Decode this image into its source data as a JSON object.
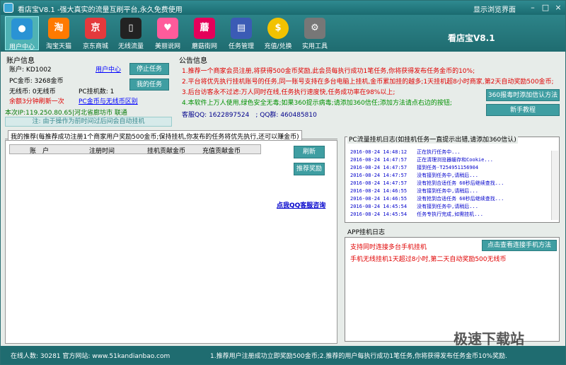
{
  "title": {
    "app": "看店宝V8.1",
    "slogan": "-强大真实的流量互刷平台,永久免费使用",
    "view": "显示浏览界面"
  },
  "toolbar": {
    "items": [
      "用户中心",
      "淘宝天猫",
      "京东商城",
      "无线流量",
      "美丽说网",
      "蘑菇街网",
      "任务管理",
      "充值/兑换",
      "实用工具"
    ],
    "brand": "看店宝V8.1"
  },
  "account": {
    "header": "账户信息",
    "account_label": "账户:",
    "account": "KD1002",
    "user_center": "用户中心",
    "pc_coins": "PC金币: 3268金币",
    "wireless": "无线币: 0无线币",
    "pc_hook": "PC挂机数: 1",
    "refresh": "余额3分钟刷新一次",
    "diff_link": "PC金币与无线币区别",
    "ip": "本次IP:119.250.80.65|河北省廊坊市 联通",
    "stop_btn": "停止任务",
    "pause_btn": "我的任务",
    "status_bar": "注: 由于操作为前时间过后间会自动挂机"
  },
  "announce": {
    "header": "公告信息",
    "lines": [
      "1.推荐一个商家会员注册,将获得500金币奖励,此会员每执行成功1笔任务,你将获得发布任务金币的10%;",
      "2.平台将优先执行挂机账号的任务,同一账号支持在多台电脑上挂机,金币累加挂的越多;1天挂机超8小时商家,第2天自动奖励500金币;",
      "3.后台访客永不过滤:万人同时在线,任务执行速度快,任务成功率在98%以上;",
      "4.本软件上万人使用,绿色安全无毒;如果360提示病毒;请添加360信任;添加方法请点右边的按钮;"
    ],
    "qq_label": "客服QQ:",
    "qq1": "1622897524",
    "qq2_label": "QQ群:",
    "qq2": "460485810",
    "btn_360": "360报毒时添加信认方法",
    "btn_tutorial": "新手教程"
  },
  "recommend": {
    "tab": "我的推荐(每推荐成功注册1个商家用户奖励500金币;保持挂机,你发布的任务将优先执行,还可以赚金币)",
    "cols": [
      "账　户",
      "注册时间",
      "挂机贡献金币",
      "充值贡献金币"
    ],
    "refresh": "刷新",
    "reward": "推荐奖励",
    "qq_link": "点我QQ客服咨询"
  },
  "log": {
    "header": "PC流量挂机日志(如挂机任务一直提示出错,请添加360信认)",
    "lines": [
      "2016-08-24 14:48:12　　正在执行任务中...",
      "2016-08-24 14:47:57　　正在清理浏览器缓存和Cookie...",
      "2016-08-24 14:47:57　　接到任务-T254951156904",
      "2016-08-24 14:47:57　　没有接到任务中,请稍后...",
      "2016-08-24 14:47:57　　没有抢到合适任务 60秒后继续查找...",
      "2016-08-24 14:46:55　　没有接到任务中,请稍后...",
      "2016-08-24 14:46:55　　没有抢到合适任务 60秒后继续查找...",
      "2016-08-24 14:45:54　　没有接到任务中,请稍后...",
      "2016-08-24 14:45:54　　任务专执行完成,如需挂机..."
    ]
  },
  "app": {
    "header": "APP挂机日志",
    "line1": "支持同时连接多台手机挂机",
    "btn": "点击查看连接手机方法",
    "line2": "手机无线挂机1天超过8小时,第二天自动奖励500无线币"
  },
  "status": {
    "left": "在线人数: 30281 官方网站: www.51kandianbao.com",
    "right": "1.推荐用户注册成功立即奖励500金币;2.推荐的用户每执行成功1笔任务,你将获得发布任务金币10%奖励."
  },
  "watermark": "极速下载站"
}
